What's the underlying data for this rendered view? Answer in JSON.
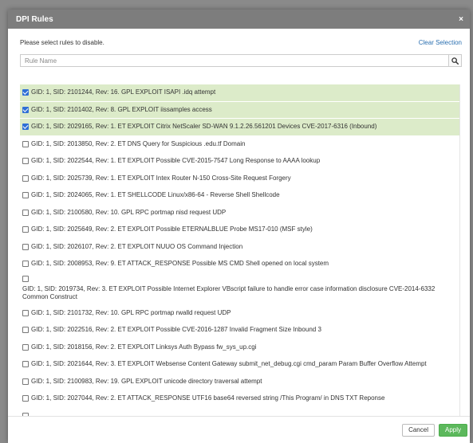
{
  "modal": {
    "title": "DPI Rules",
    "close_symbol": "×",
    "instruction": "Please select rules to disable.",
    "clear_selection": "Clear Selection"
  },
  "search": {
    "placeholder": "Rule Name",
    "icon": "search-icon"
  },
  "rules": [
    {
      "label": "GID: 1, SID: 2101244, Rev: 16. GPL EXPLOIT ISAPI .idq attempt",
      "checked": true
    },
    {
      "label": "GID: 1, SID: 2101402, Rev: 8. GPL EXPLOIT iissamples access",
      "checked": true
    },
    {
      "label": "GID: 1, SID: 2029165, Rev: 1. ET EXPLOIT Citrix NetScaler SD-WAN 9.1.2.26.561201 Devices CVE-2017-6316 (Inbound)",
      "checked": true
    },
    {
      "label": "GID: 1, SID: 2013850, Rev: 2. ET DNS Query for Suspicious .edu.tf Domain",
      "checked": false
    },
    {
      "label": "GID: 1, SID: 2022544, Rev: 1. ET EXPLOIT Possible CVE-2015-7547 Long Response to AAAA lookup",
      "checked": false
    },
    {
      "label": "GID: 1, SID: 2025739, Rev: 1. ET EXPLOIT Intex Router N-150 Cross-Site Request Forgery",
      "checked": false
    },
    {
      "label": "GID: 1, SID: 2024065, Rev: 1. ET SHELLCODE Linux/x86-64 - Reverse Shell Shellcode",
      "checked": false
    },
    {
      "label": "GID: 1, SID: 2100580, Rev: 10. GPL RPC portmap nisd request UDP",
      "checked": false
    },
    {
      "label": "GID: 1, SID: 2025649, Rev: 2. ET EXPLOIT Possible ETERNALBLUE Probe MS17-010 (MSF style)",
      "checked": false
    },
    {
      "label": "GID: 1, SID: 2026107, Rev: 2. ET EXPLOIT NUUO OS Command Injection",
      "checked": false
    },
    {
      "label": "GID: 1, SID: 2008953, Rev: 9. ET ATTACK_RESPONSE Possible MS CMD Shell opened on local system",
      "checked": false
    },
    {
      "label": "GID: 1, SID: 2019734, Rev: 3. ET EXPLOIT Possible Internet Explorer VBscript failure to handle error case information disclosure CVE-2014-6332 Common Construct",
      "checked": false,
      "multi": true
    },
    {
      "label": "GID: 1, SID: 2101732, Rev: 10. GPL RPC portmap rwalld request UDP",
      "checked": false
    },
    {
      "label": "GID: 1, SID: 2022516, Rev: 2. ET EXPLOIT Possible CVE-2016-1287 Invalid Fragment Size Inbound 3",
      "checked": false
    },
    {
      "label": "GID: 1, SID: 2018156, Rev: 2. ET EXPLOIT Linksys Auth Bypass fw_sys_up.cgi",
      "checked": false
    },
    {
      "label": "GID: 1, SID: 2021644, Rev: 3. ET EXPLOIT Websense Content Gateway submit_net_debug.cgi cmd_param Param Buffer Overflow Attempt",
      "checked": false
    },
    {
      "label": "GID: 1, SID: 2100983, Rev: 19. GPL EXPLOIT unicode directory traversal attempt",
      "checked": false
    },
    {
      "label": "GID: 1, SID: 2027044, Rev: 2. ET ATTACK_RESPONSE UTF16 base64 reversed string /This Program/ in DNS TXT Reponse",
      "checked": false
    },
    {
      "label": "",
      "checked": false
    }
  ],
  "footer": {
    "cancel_label": "Cancel",
    "apply_label": "Apply"
  },
  "colors": {
    "header_bg": "#7d7d7d",
    "selected_row_bg": "#dcebc9",
    "checkbox_blue": "#2f6fd6",
    "apply_green": "#5cb85c",
    "link_blue": "#2a6fb0"
  }
}
